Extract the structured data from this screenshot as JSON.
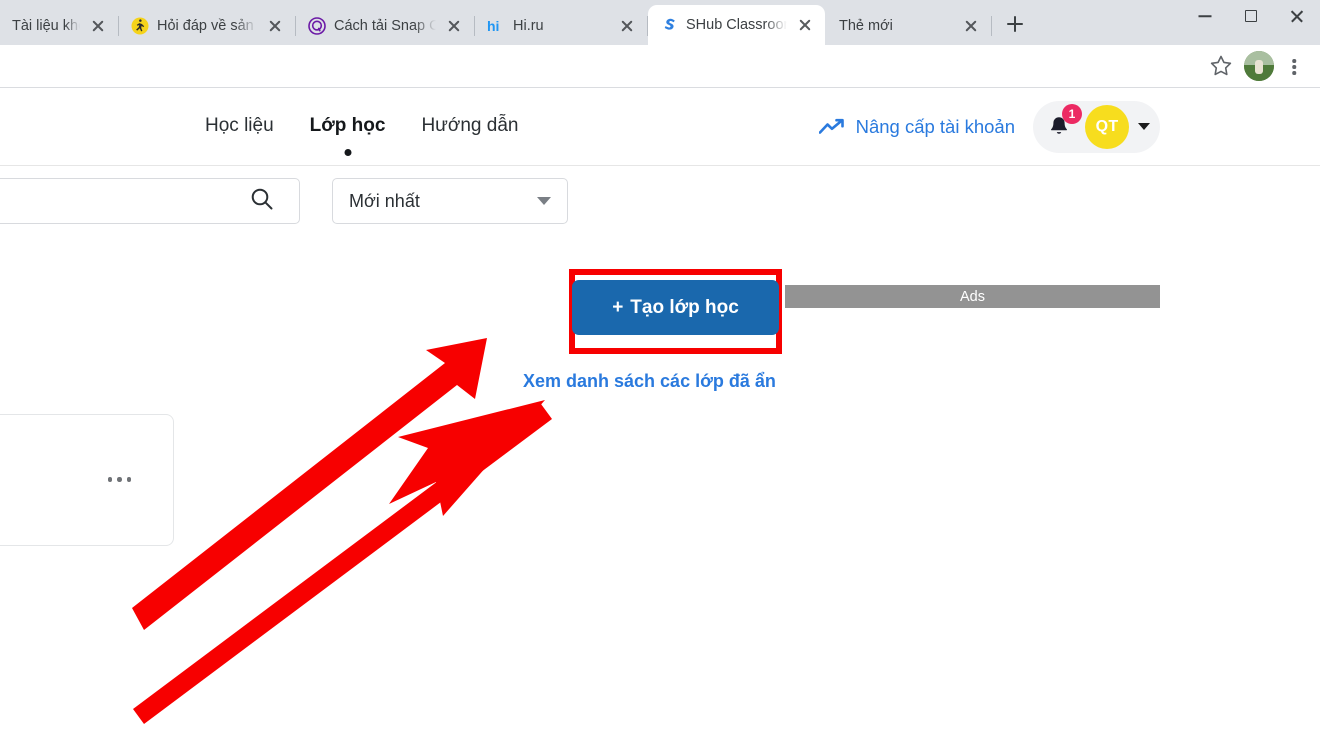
{
  "browser": {
    "tabs": [
      {
        "title": "Tài liệu không c",
        "favicon": "none",
        "active": false
      },
      {
        "title": "Hỏi đáp về sản",
        "favicon": "yellow-runner-icon",
        "active": false
      },
      {
        "title": "Cách tải Snap C",
        "favicon": "purple-q-icon",
        "active": false
      },
      {
        "title": "Hi.ru",
        "favicon": "hi-ru-icon",
        "active": false
      },
      {
        "title": "SHub Classroom",
        "favicon": "shub-s-icon",
        "active": true
      },
      {
        "title": "Thẻ mới",
        "favicon": "none",
        "active": false
      }
    ],
    "newtab_label": "+",
    "window_controls": {
      "minimize": "−",
      "maximize": "□",
      "close": "✕"
    },
    "toolbar": {
      "bookmark": "star-icon",
      "profile": "profile-avatar",
      "menu": "kebab-menu-icon"
    }
  },
  "site": {
    "nav": [
      {
        "label": "Học liệu",
        "active": false
      },
      {
        "label": "Lớp học",
        "active": true
      },
      {
        "label": "Hướng dẫn",
        "active": false
      }
    ],
    "upgrade_label": "Nâng cấp tài khoản",
    "notification_count": "1",
    "avatar_initials": "QT"
  },
  "controls": {
    "search_placeholder": "",
    "search_value": "",
    "sort_value": "Mới nhất",
    "create_class_label": "+ Tạo lớp học",
    "create_class_plus": "+",
    "create_class_text": "Tạo lớp học"
  },
  "ads": {
    "label": "Ads"
  },
  "links": {
    "hidden_classes": "Xem danh sách các lớp đã ẩn"
  },
  "card": {
    "overflow_menu": "more-options-icon"
  },
  "annotations": {
    "highlight_target": "create-class-button",
    "arrow_color": "#f70000",
    "highlight_color": "#f70000"
  },
  "colors": {
    "primary_blue": "#1a68ad",
    "link_blue": "#2a7ade",
    "avatar_yellow": "#f7dd1e",
    "badge_pink": "#ec2a63",
    "ads_gray": "#939393",
    "annotation_red": "#f70000"
  }
}
